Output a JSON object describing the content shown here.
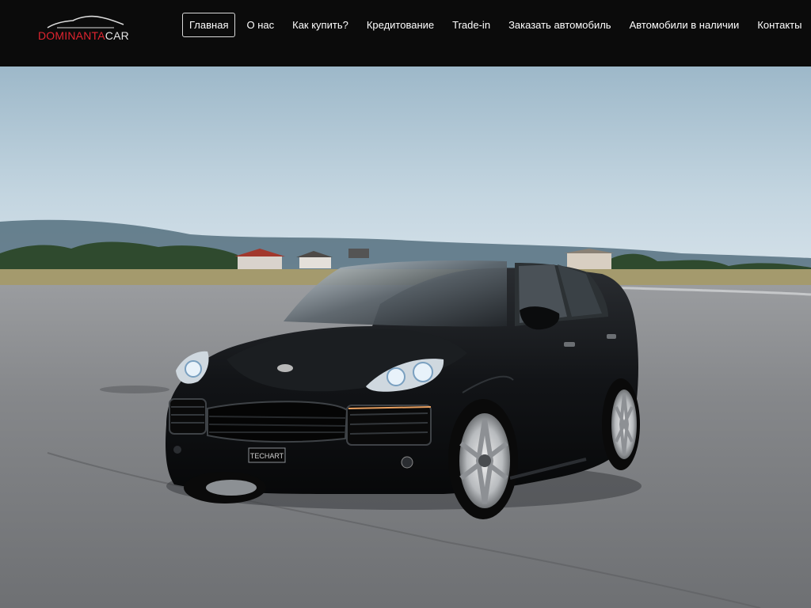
{
  "brand": {
    "name_part1": "DOMINANTA",
    "name_part2": "CAR"
  },
  "nav": {
    "items": [
      {
        "label": "Главная",
        "active": true
      },
      {
        "label": "О нас"
      },
      {
        "label": "Как купить?"
      },
      {
        "label": "Кредитование"
      },
      {
        "label": "Trade-in"
      },
      {
        "label": "Заказать автомобиль"
      },
      {
        "label": "Автомобили в наличии"
      },
      {
        "label": "Контакты"
      }
    ]
  },
  "hero": {
    "plate_text": "TECHART"
  },
  "colors": {
    "header_bg": "#0b0b0b",
    "brand_red": "#e0242f",
    "sky": "#b9cfdc",
    "asphalt": "#7d7f82",
    "car_body": "#121417"
  }
}
